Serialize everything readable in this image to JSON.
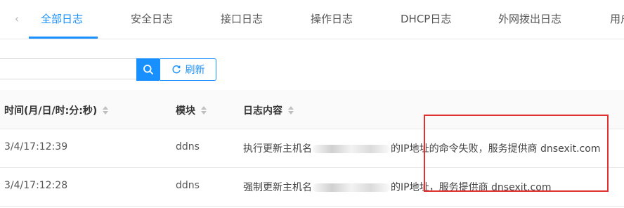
{
  "tabs": {
    "items": [
      {
        "label": "全部日志",
        "active": true
      },
      {
        "label": "安全日志",
        "active": false
      },
      {
        "label": "接口日志",
        "active": false
      },
      {
        "label": "操作日志",
        "active": false
      },
      {
        "label": "DHCP日志",
        "active": false
      },
      {
        "label": "外网拨出日志",
        "active": false
      },
      {
        "label": "用户",
        "active": false
      }
    ]
  },
  "toolbar": {
    "search_placeholder": "",
    "refresh_label": "刷新"
  },
  "table": {
    "columns": [
      "时间(月/日/时:分:秒)",
      "模块",
      "日志内容"
    ],
    "rows": [
      {
        "time": "3/4/17:12:39",
        "module": "ddns",
        "content_prefix": "执行更新主机名",
        "content_suffix": "的IP地址的命令失败，服务提供商 dnsexit.com"
      },
      {
        "time": "3/4/17:12:28",
        "module": "ddns",
        "content_prefix": "强制更新主机名",
        "content_suffix": "的IP地址，服务提供商 dnsexit.com"
      }
    ]
  },
  "colors": {
    "accent": "#1890ff",
    "annotation": "#e03030"
  }
}
